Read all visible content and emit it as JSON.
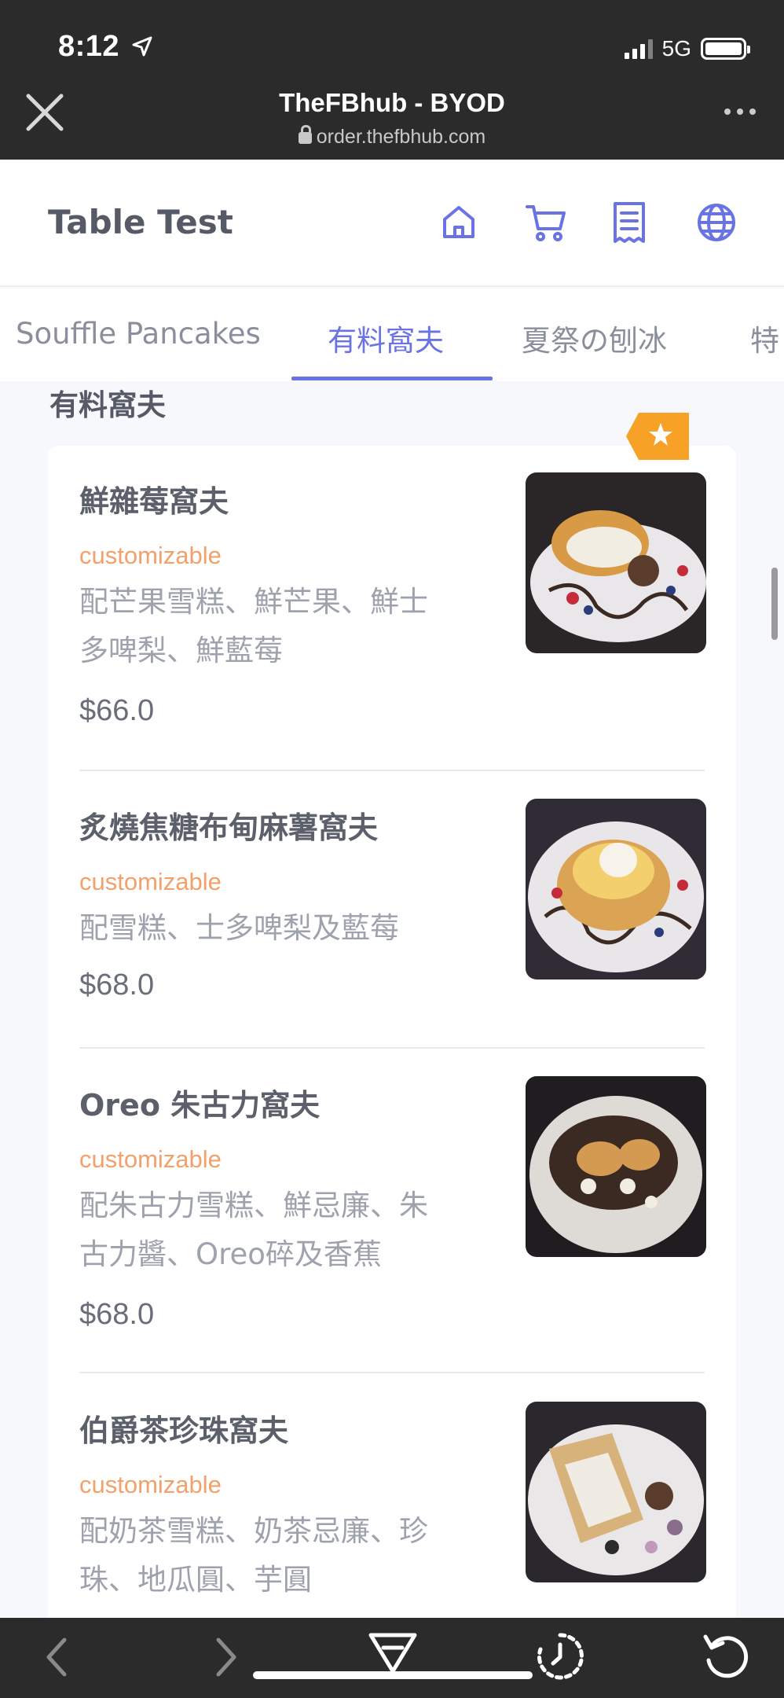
{
  "status_bar": {
    "time": "8:12",
    "network": "5G"
  },
  "browser": {
    "title": "TheFBhub - BYOD",
    "url": "order.thefbhub.com"
  },
  "header": {
    "title": "Table Test",
    "icons": [
      "home-icon",
      "cart-icon",
      "receipt-icon",
      "globe-icon"
    ],
    "accent_color": "#6a73e3"
  },
  "tabs": [
    {
      "label": "Souffle Pancakes"
    },
    {
      "label": "有料窩夫"
    },
    {
      "label": "夏祭の刨冰"
    },
    {
      "label": "特"
    }
  ],
  "active_tab": "有料窩夫",
  "section": {
    "heading": "有料窩夫"
  },
  "items": [
    {
      "name": "鮮雜莓窩夫",
      "tag": "customizable",
      "description": "配芒果雪糕、鮮芒果、鮮士多啤梨、鮮藍莓",
      "price": "$66.0",
      "featured": true
    },
    {
      "name": "炙燒焦糖布甸麻薯窩夫",
      "tag": "customizable",
      "description": "配雪糕、士多啤梨及藍莓",
      "price": "$68.0",
      "featured": false
    },
    {
      "name": "Oreo 朱古力窩夫",
      "tag": "customizable",
      "description": "配朱古力雪糕、鮮忌廉、朱古力醬、Oreo碎及香蕉",
      "price": "$68.0",
      "featured": false
    },
    {
      "name": "伯爵茶珍珠窩夫",
      "tag": "customizable",
      "description": "配奶茶雪糕、奶茶忌廉、珍珠、地瓜圓、芋圓",
      "price": "",
      "featured": false
    }
  ],
  "colors": {
    "tag": "#f3a06a",
    "badge": "#f7a227"
  }
}
